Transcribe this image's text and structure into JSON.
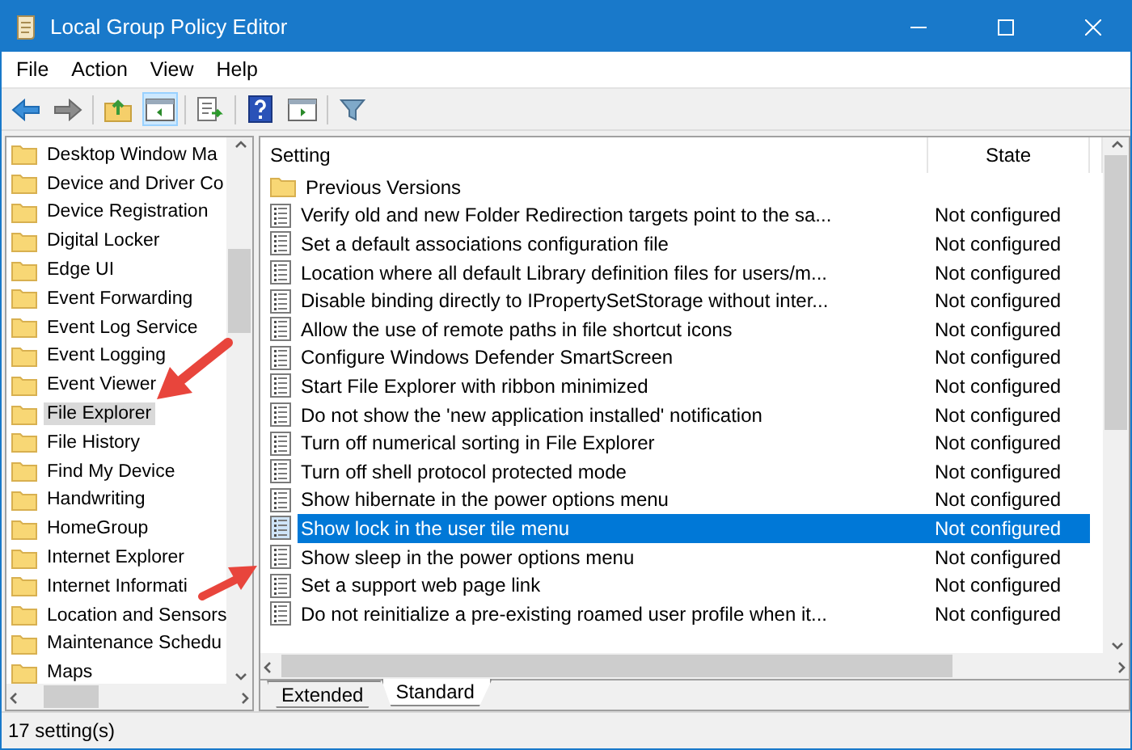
{
  "window": {
    "title": "Local Group Policy Editor"
  },
  "menu": [
    "File",
    "Action",
    "View",
    "Help"
  ],
  "tree": {
    "items": [
      {
        "label": "Desktop Window Ma",
        "selected": false
      },
      {
        "label": "Device and Driver Co",
        "selected": false
      },
      {
        "label": "Device Registration",
        "selected": false
      },
      {
        "label": "Digital Locker",
        "selected": false
      },
      {
        "label": "Edge UI",
        "selected": false
      },
      {
        "label": "Event Forwarding",
        "selected": false
      },
      {
        "label": "Event Log Service",
        "selected": false
      },
      {
        "label": "Event Logging",
        "selected": false
      },
      {
        "label": "Event Viewer",
        "selected": false
      },
      {
        "label": "File Explorer",
        "selected": true
      },
      {
        "label": "File History",
        "selected": false
      },
      {
        "label": "Find My Device",
        "selected": false
      },
      {
        "label": "Handwriting",
        "selected": false
      },
      {
        "label": "HomeGroup",
        "selected": false
      },
      {
        "label": "Internet Explorer",
        "selected": false
      },
      {
        "label": "Internet Informati",
        "selected": false
      },
      {
        "label": "Location and Sensors",
        "selected": false
      },
      {
        "label": "Maintenance Schedu",
        "selected": false
      },
      {
        "label": "Maps",
        "selected": false
      }
    ]
  },
  "table": {
    "columns": [
      "Setting",
      "State"
    ],
    "rows": [
      {
        "kind": "folder",
        "setting": "Previous Versions",
        "selected": false
      },
      {
        "kind": "policy",
        "setting": "Verify old and new Folder Redirection targets point to the sa...",
        "state": "Not configured",
        "selected": false
      },
      {
        "kind": "policy",
        "setting": "Set a default associations configuration file",
        "state": "Not configured",
        "selected": false
      },
      {
        "kind": "policy",
        "setting": "Location where all default Library definition files for users/m...",
        "state": "Not configured",
        "selected": false
      },
      {
        "kind": "policy",
        "setting": "Disable binding directly to IPropertySetStorage without inter...",
        "state": "Not configured",
        "selected": false
      },
      {
        "kind": "policy",
        "setting": "Allow the use of remote paths in file shortcut icons",
        "state": "Not configured",
        "selected": false
      },
      {
        "kind": "policy",
        "setting": "Configure Windows Defender SmartScreen",
        "state": "Not configured",
        "selected": false
      },
      {
        "kind": "policy",
        "setting": "Start File Explorer with ribbon minimized",
        "state": "Not configured",
        "selected": false
      },
      {
        "kind": "policy",
        "setting": "Do not show the 'new application installed' notification",
        "state": "Not configured",
        "selected": false
      },
      {
        "kind": "policy",
        "setting": "Turn off numerical sorting in File Explorer",
        "state": "Not configured",
        "selected": false
      },
      {
        "kind": "policy",
        "setting": "Turn off shell protocol protected mode",
        "state": "Not configured",
        "selected": false
      },
      {
        "kind": "policy",
        "setting": "Show hibernate in the power options menu",
        "state": "Not configured",
        "selected": false
      },
      {
        "kind": "policy",
        "setting": "Show lock in the user tile menu",
        "state": "Not configured",
        "selected": true
      },
      {
        "kind": "policy",
        "setting": "Show sleep in the power options menu",
        "state": "Not configured",
        "selected": false
      },
      {
        "kind": "policy",
        "setting": "Set a support web page link",
        "state": "Not configured",
        "selected": false
      },
      {
        "kind": "policy",
        "setting": "Do not reinitialize a pre-existing roamed user profile when it...",
        "state": "Not configured",
        "selected": false
      }
    ]
  },
  "tabs": [
    {
      "label": "Extended",
      "selected": false
    },
    {
      "label": "Standard",
      "selected": true
    }
  ],
  "status_bar": "17 setting(s)"
}
